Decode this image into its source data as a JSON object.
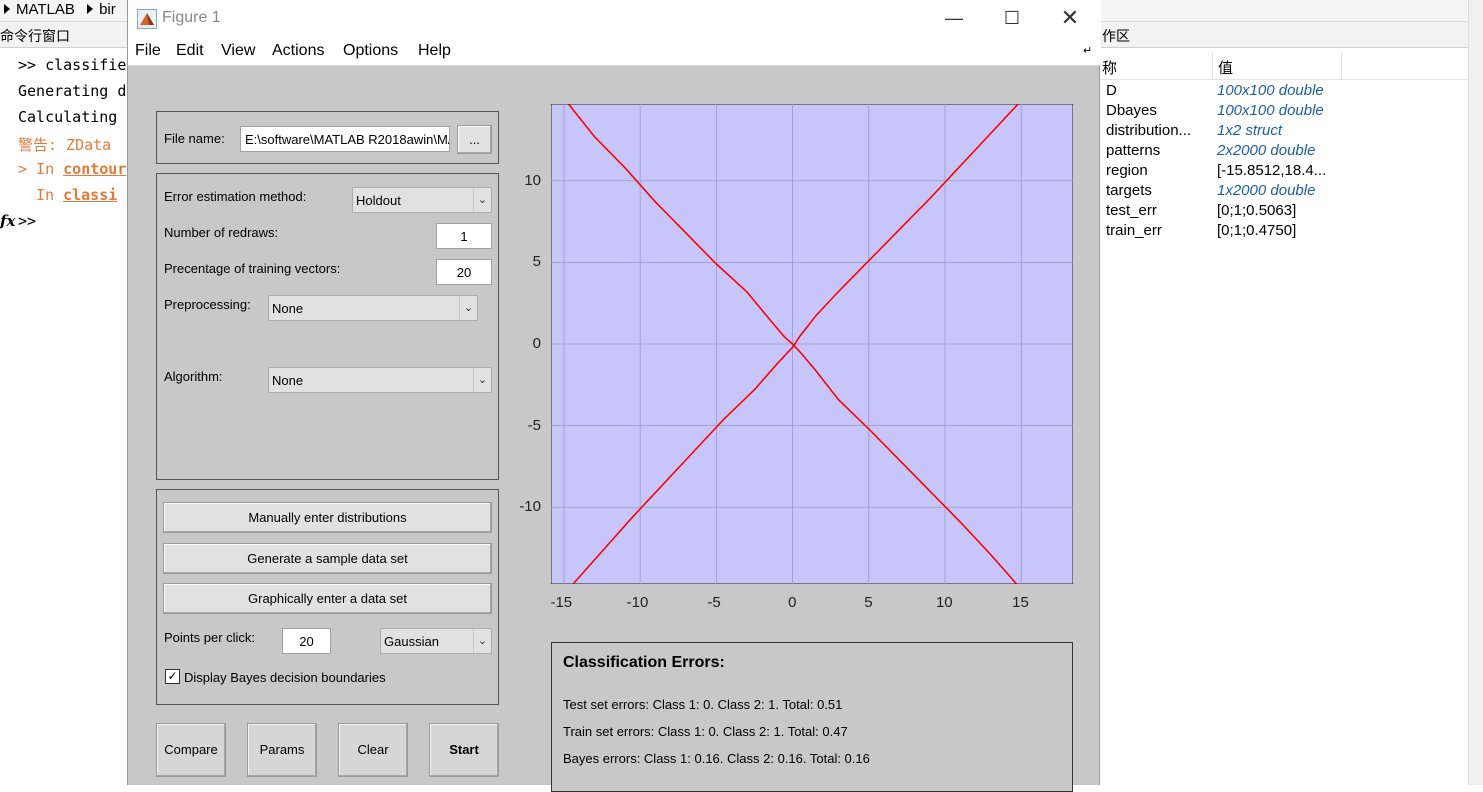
{
  "background": {
    "breadcrumb": [
      "MATLAB",
      "bir"
    ],
    "command_window_title": "命令行窗口",
    "command_lines": [
      {
        "prompt": ">> ",
        "text": "classifie",
        "kind": "normal"
      },
      {
        "prompt": "",
        "text": "Generating d",
        "kind": "normal"
      },
      {
        "prompt": "",
        "text": "Calculating",
        "kind": "normal"
      },
      {
        "prompt": "",
        "text": "警告: ZData",
        "kind": "warn"
      }
    ],
    "warn_in_1_prefix": "> In ",
    "warn_in_1_link": "contour",
    "warn_in_2_prefix": "In ",
    "warn_in_2_link": "classi",
    "prompt_line": ">>",
    "fx_symbol": "fx",
    "workspace_title": "作区",
    "workspace_col_name": "称",
    "workspace_col_value": "值",
    "workspace_vars": [
      {
        "name": "D",
        "value": "100x100 double",
        "style": "blue"
      },
      {
        "name": "Dbayes",
        "value": "100x100 double",
        "style": "blue"
      },
      {
        "name": "distribution...",
        "value": "1x2 struct",
        "style": "blue"
      },
      {
        "name": "patterns",
        "value": "2x2000 double",
        "style": "blue"
      },
      {
        "name": "region",
        "value": "[-15.8512,18.4...",
        "style": "plain"
      },
      {
        "name": "targets",
        "value": "1x2000 double",
        "style": "blue"
      },
      {
        "name": "test_err",
        "value": "[0;1;0.5063]",
        "style": "plain"
      },
      {
        "name": "train_err",
        "value": "[0;1;0.4750]",
        "style": "plain"
      }
    ]
  },
  "figure": {
    "title": "Figure 1",
    "menu": [
      "File",
      "Edit",
      "View",
      "Actions",
      "Options",
      "Help"
    ],
    "file_name_label": "File name:",
    "file_name_value": "E:\\software\\MATLAB R2018awin\\MA",
    "browse_label": "...",
    "error_method_label": "Error estimation method:",
    "error_method_value": "Holdout",
    "redraws_label": "Number of redraws:",
    "redraws_value": "1",
    "training_pct_label": "Precentage of training vectors:",
    "training_pct_value": "20",
    "preprocessing_label": "Preprocessing:",
    "preprocessing_value": "None",
    "algorithm_label": "Algorithm:",
    "algorithm_value": "None",
    "btn_manual": "Manually enter distributions",
    "btn_generate": "Generate a sample data set",
    "btn_graphical": "Graphically enter a data set",
    "points_per_click_label": "Points per click:",
    "points_per_click_value": "20",
    "distribution_value": "Gaussian",
    "display_bayes_label": "Display Bayes decision boundaries",
    "display_bayes_checked": true,
    "btn_compare": "Compare",
    "btn_params": "Params",
    "btn_clear": "Clear",
    "btn_start": "Start",
    "errors_title": "Classification Errors:",
    "errors_test": "Test set errors: Class 1: 0. Class 2: 1. Total: 0.51",
    "errors_train": "Train set errors: Class 1: 0. Class 2: 1. Total: 0.47",
    "errors_bayes": "Bayes errors: Class 1: 0.16. Class 2: 0.16. Total: 0.16"
  },
  "chart_data": {
    "type": "line",
    "xlim": [
      -15.85,
      18.4
    ],
    "ylim": [
      -14.7,
      14.7
    ],
    "xticks": [
      -15,
      -10,
      -5,
      0,
      5,
      10,
      15
    ],
    "yticks": [
      -10,
      -5,
      0,
      5,
      10
    ],
    "grid": true,
    "background_color": "#c6c6fa",
    "line_color": "#ff0000",
    "series": [
      {
        "x": [
          -14.7,
          -13.0,
          -11.0,
          -9.0,
          -7.0,
          -5.0,
          -3.0,
          -1.5,
          -0.5,
          0.0,
          0.5,
          1.5,
          3.0,
          5.0,
          7.0,
          9.0,
          11.0,
          13.0,
          14.7
        ],
        "y": [
          14.7,
          12.7,
          10.8,
          8.7,
          6.8,
          4.9,
          3.2,
          1.5,
          0.4,
          0.0,
          -0.5,
          -1.6,
          -3.4,
          -5.2,
          -7.1,
          -9.0,
          -10.9,
          -12.9,
          -14.7
        ]
      },
      {
        "x": [
          -14.4,
          -12.5,
          -10.5,
          -8.5,
          -6.5,
          -4.5,
          -2.5,
          -1.0,
          0.0,
          0.5,
          1.5,
          3.0,
          5.0,
          7.0,
          9.0,
          11.0,
          13.0,
          14.8
        ],
        "y": [
          -14.7,
          -12.7,
          -10.6,
          -8.6,
          -6.6,
          -4.6,
          -2.8,
          -1.2,
          -0.2,
          0.5,
          1.7,
          3.2,
          5.1,
          7.0,
          8.9,
          10.9,
          12.9,
          14.7
        ]
      }
    ]
  },
  "colors": {
    "figure_bg": "#c8c8c8",
    "warning": "#e07b39",
    "workspace_value_blue": "#1f5fa0"
  }
}
